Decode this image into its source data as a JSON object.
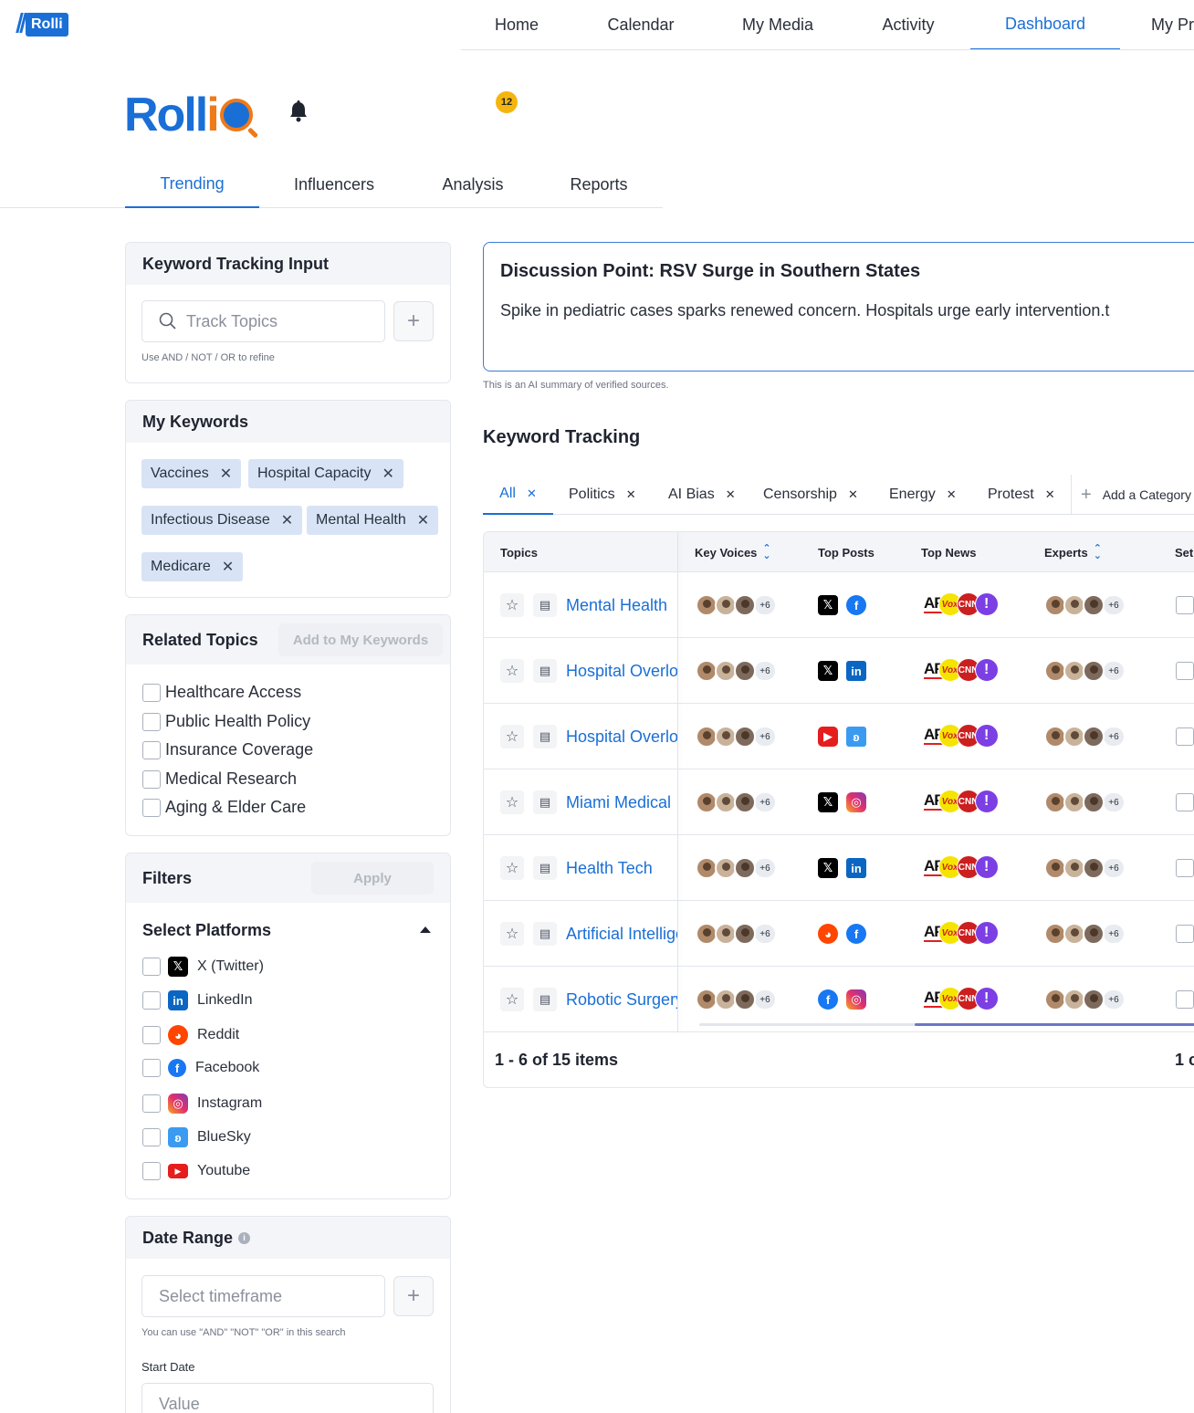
{
  "brand_badge": "Rolli",
  "topnav": [
    "Home",
    "Calendar",
    "My Media",
    "Activity",
    "Dashboard",
    "My Pr"
  ],
  "topnav_active": "Dashboard",
  "brand": {
    "part1": "Roll",
    "part2": "i"
  },
  "notifications_count": "12",
  "subtabs": [
    "Trending",
    "Influencers",
    "Analysis",
    "Reports"
  ],
  "keyword_input": {
    "title": "Keyword Tracking Input",
    "placeholder": "Track Topics",
    "hint": "Use AND / NOT / OR to refine"
  },
  "my_keywords": {
    "title": "My Keywords",
    "items": [
      "Vaccines",
      "Hospital Capacity",
      "Infectious Disease",
      "Mental Health",
      "Medicare"
    ]
  },
  "related_topics": {
    "title": "Related Topics",
    "add_button": "Add to My Keywords",
    "items": [
      "Healthcare Access",
      "Public Health Policy",
      "Insurance Coverage",
      "Medical Research",
      "Aging & Elder Care"
    ]
  },
  "filters": {
    "title": "Filters",
    "apply": "Apply",
    "platforms_title": "Select Platforms",
    "platforms": [
      "X (Twitter)",
      "LinkedIn",
      "Reddit",
      "Facebook",
      "Instagram",
      "BlueSky",
      "Youtube"
    ]
  },
  "date_range": {
    "title": "Date Range",
    "placeholder": "Select timeframe",
    "hint": "You can use \"AND\" \"NOT\" \"OR\" in this search",
    "start_label": "Start Date",
    "start_placeholder": "Value"
  },
  "discussion": {
    "title": "Discussion Point: RSV Surge in Southern States",
    "text": "Spike in pediatric cases sparks renewed concern. Hospitals urge early intervention.t",
    "note": "This is an AI summary of verified sources."
  },
  "keyword_tracking": {
    "title": "Keyword Tracking",
    "categories": [
      "All",
      "Politics",
      "AI Bias",
      "Censorship",
      "Energy",
      "Protest"
    ],
    "add_category": "Add a Category",
    "columns": [
      "Topics",
      "Key Voices",
      "Top Posts",
      "Top News",
      "Experts",
      "Set"
    ],
    "more_count": "+6",
    "rows": [
      {
        "topic": "Mental Health",
        "posts": [
          "x",
          "facebook"
        ]
      },
      {
        "topic": "Hospital Overload",
        "posts": [
          "x",
          "linkedin"
        ]
      },
      {
        "topic": "Hospital Overload",
        "posts": [
          "youtube",
          "bluesky"
        ]
      },
      {
        "topic": "Miami Medical",
        "posts": [
          "x",
          "instagram"
        ]
      },
      {
        "topic": "Health Tech",
        "posts": [
          "x",
          "linkedin"
        ]
      },
      {
        "topic": "Artificial Intelligence",
        "posts": [
          "reddit",
          "facebook"
        ]
      },
      {
        "topic": "Robotic Surgery",
        "posts": [
          "facebook",
          "instagram"
        ]
      }
    ],
    "news_sources": [
      "AP",
      "Vox",
      "CNN",
      "!"
    ],
    "pager": "1 - 6 of 15 items",
    "pager_right": "1 c"
  },
  "colors": {
    "accent": "#1a6fd6",
    "brand_orange": "#ee7a1a",
    "badge": "#f5b50f"
  }
}
